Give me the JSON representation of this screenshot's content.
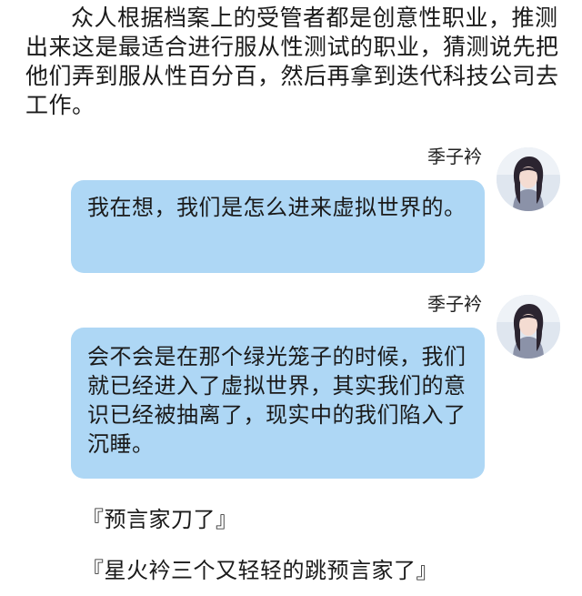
{
  "narration": "众人根据档案上的受管者都是创意性职业，推测出来这是最适合进行服从性测试的职业，猜测说先把他们弄到服从性百分百，然后再拿到迭代科技公司去工作。",
  "messages": [
    {
      "sender": "季子衿",
      "avatar_icon": "avatar-girl-icon",
      "text": "我在想，我们是怎么进来虚拟世界的。"
    },
    {
      "sender": "季子衿",
      "avatar_icon": "avatar-girl-icon",
      "text": "会不会是在那个绿光笼子的时候，我们就已经进入了虚拟世界，其实我们的意识已经被抽离了，现实中的我们陷入了沉睡。"
    }
  ],
  "comments": [
    "『预言家刀了』",
    "『星火衿三个又轻轻的跳预言家了』"
  ],
  "colors": {
    "bubble": "#aed7f5",
    "text": "#1a1a1a",
    "background": "#ffffff"
  }
}
